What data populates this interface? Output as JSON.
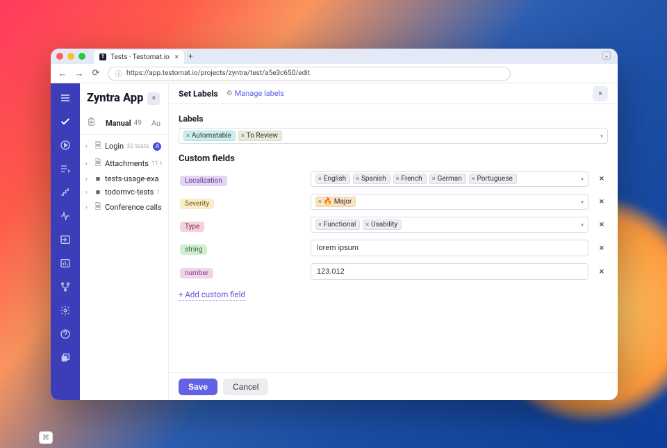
{
  "browser": {
    "tab_title": "Tests · Testomat.io",
    "url": "https://app.testomat.io/projects/zyntra/test/a5e3c650/edit"
  },
  "project": {
    "name": "Zyntra App"
  },
  "tabs": {
    "manual_label": "Manual",
    "manual_count": "49",
    "auto_label": "Au"
  },
  "tree": [
    {
      "icon": "file",
      "name": "Login",
      "count": "32 tests",
      "badge": "A"
    },
    {
      "icon": "file",
      "name": "Attachments",
      "count": "11 t"
    },
    {
      "icon": "folder",
      "name": "tests-usage-exa",
      "count": ""
    },
    {
      "icon": "folder",
      "name": "todomvc-tests",
      "count": "1"
    },
    {
      "icon": "file",
      "name": "Conference calls",
      "count": ""
    }
  ],
  "panel": {
    "title": "Set Labels",
    "manage": "Manage labels",
    "labels_heading": "Labels",
    "custom_heading": "Custom fields",
    "add_field": "+ Add custom field"
  },
  "labels_chips": [
    "Automatable",
    "To Review"
  ],
  "fields": {
    "localization": {
      "name": "Localization",
      "values": [
        "English",
        "Spanish",
        "French",
        "German",
        "Portuguese"
      ]
    },
    "severity": {
      "name": "Severity",
      "values": [
        "🔥 Major"
      ]
    },
    "type": {
      "name": "Type",
      "values": [
        "Functional",
        "Usability"
      ]
    },
    "string": {
      "name": "string",
      "value": "lorem ipsum"
    },
    "number": {
      "name": "number",
      "value": "123.012"
    }
  },
  "footer": {
    "save": "Save",
    "cancel": "Cancel"
  }
}
